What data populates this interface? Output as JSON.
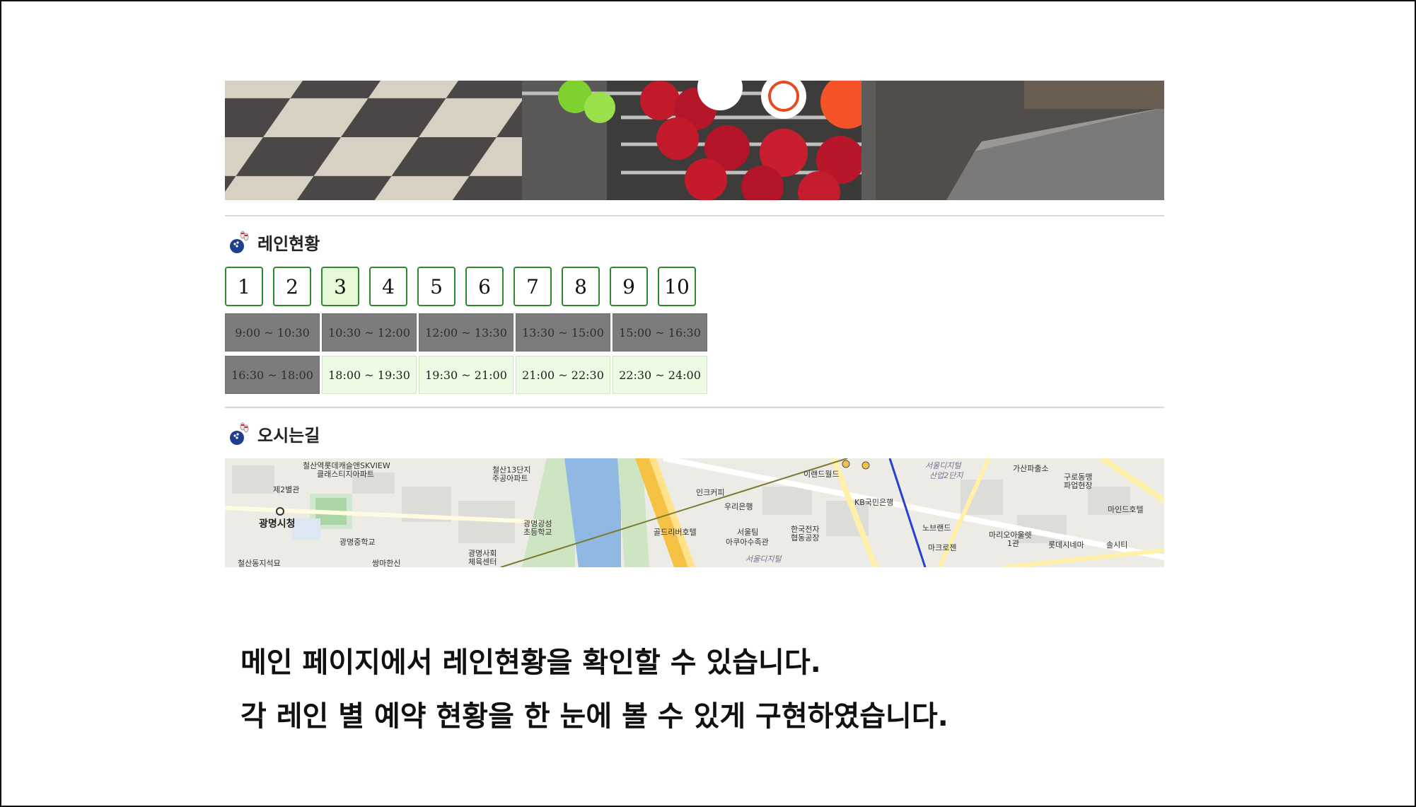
{
  "lane_section": {
    "title": "레인현황"
  },
  "lanes": [
    {
      "label": "1",
      "active": false
    },
    {
      "label": "2",
      "active": false
    },
    {
      "label": "3",
      "active": true
    },
    {
      "label": "4",
      "active": false
    },
    {
      "label": "5",
      "active": false
    },
    {
      "label": "6",
      "active": false
    },
    {
      "label": "7",
      "active": false
    },
    {
      "label": "8",
      "active": false
    },
    {
      "label": "9",
      "active": false
    },
    {
      "label": "10",
      "active": false
    }
  ],
  "time_slots": [
    {
      "label": "9:00 ~ 10:30",
      "status": "booked"
    },
    {
      "label": "10:30 ~ 12:00",
      "status": "booked"
    },
    {
      "label": "12:00 ~ 13:30",
      "status": "booked"
    },
    {
      "label": "13:30 ~ 15:00",
      "status": "booked"
    },
    {
      "label": "15:00 ~ 16:30",
      "status": "booked"
    },
    {
      "label": "16:30 ~ 18:00",
      "status": "booked"
    },
    {
      "label": "18:00 ~ 19:30",
      "status": "open"
    },
    {
      "label": "19:30 ~ 21:00",
      "status": "open"
    },
    {
      "label": "21:00 ~ 22:30",
      "status": "open"
    },
    {
      "label": "22:30 ~ 24:00",
      "status": "open"
    }
  ],
  "directions_section": {
    "title": "오시는길"
  },
  "map": {
    "labels": {
      "l1": "철산역롯데캐슬앤SKVIEW",
      "l2": "클래스티지아파트",
      "l3": "제2별관",
      "l4": "광명시청",
      "l5": "광명중학교",
      "l6": "철산13단지",
      "l7": "주공아파트",
      "l8": "광명광성",
      "l9": "초등학교",
      "l10": "광명사회",
      "l11": "체육센터",
      "l12": "인크커피",
      "l13": "우리은행",
      "l14": "골드리버호텔",
      "l15": "서울팀",
      "l16": "아쿠아수족관",
      "l17": "한국전자",
      "l18": "협동공장",
      "l19": "이랜드월드",
      "l20": "KB국민은행",
      "l21": "서울디지털",
      "l22": "산업2단지",
      "l23": "가산파출소",
      "l24": "구로동맹",
      "l25": "파업현장",
      "l26": "마인드호텔",
      "l27": "노브랜드",
      "l28": "마크로젠",
      "l29": "마리오아울렛",
      "l30": "1관",
      "l31": "롯데시네마",
      "l32": "솔시티",
      "l33": "철산동지석묘",
      "l34": "쌍마한신",
      "l35": "서울디지털"
    }
  },
  "captions": {
    "line1": "메인 페이지에서 레인현황을 확인할 수 있습니다.",
    "line2": "각 레인 별 예약 현황을 한 눈에 볼 수 있게 구현하였습니다."
  },
  "colors": {
    "lane_border": "#2c8a2c",
    "lane_active_bg": "#e6f8d6",
    "slot_booked_bg": "#7c7c7c",
    "slot_open_bg": "#eefbe4"
  }
}
